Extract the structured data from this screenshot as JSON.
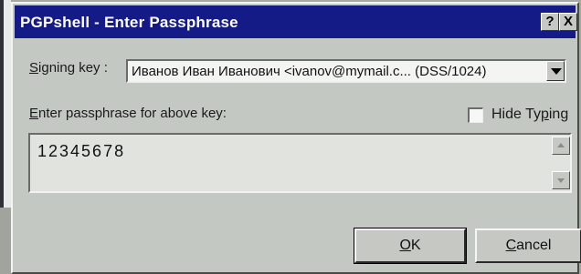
{
  "window": {
    "title": "PGPshell - Enter Passphrase",
    "help_button": "?",
    "close_button": "X"
  },
  "signing_key": {
    "label_accel": "S",
    "label_rest": "igning key :",
    "selected": "Иванов Иван Иванович <ivanov@mymail.c...   (DSS/1024)"
  },
  "passphrase": {
    "prompt_accel": "E",
    "prompt_rest": "nter passphrase for above key:",
    "value": "12345678"
  },
  "hide_typing": {
    "label_before": "Hide Ty",
    "label_accel": "p",
    "label_after": "ing",
    "checked": false
  },
  "buttons": {
    "ok_accel": "O",
    "ok_rest": "K",
    "cancel_accel": "C",
    "cancel_rest": "ancel"
  }
}
